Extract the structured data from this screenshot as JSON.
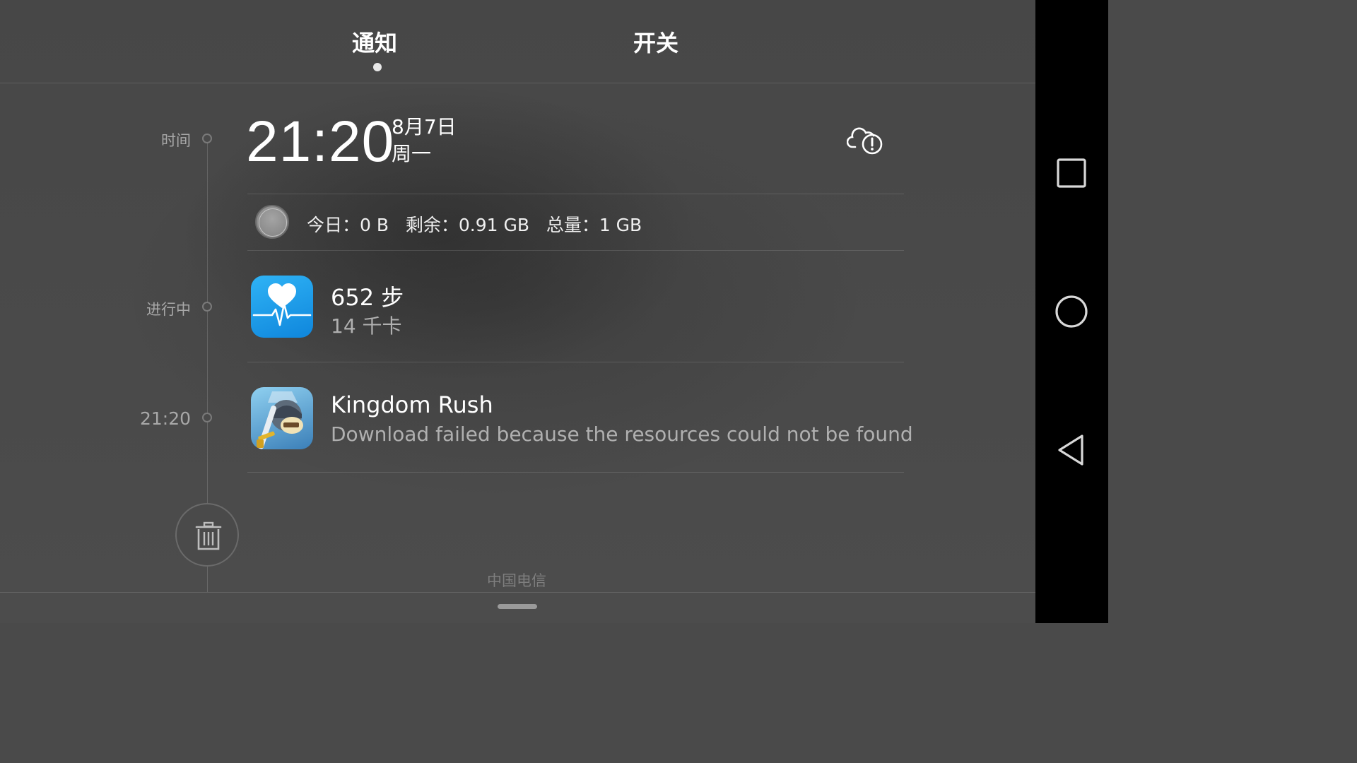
{
  "tabs": {
    "notifications_label": "通知",
    "switches_label": "开关",
    "active": "notifications_label"
  },
  "timeline": {
    "time_label": "时间",
    "ongoing_label": "进行中",
    "notif_time": "21:20"
  },
  "clock": {
    "time": "21:20",
    "date": "8月7日",
    "weekday": "周一",
    "weather_icon": "cloud-alert-icon"
  },
  "data_usage": {
    "text": "今日：0 B   剩余：0.91 GB   总量：1 GB"
  },
  "notifications": [
    {
      "app_icon": "health-heart-icon",
      "title": "652 步",
      "subtitle": "14 千卡"
    },
    {
      "app_icon": "kingdom-rush-icon",
      "title": "Kingdom Rush",
      "subtitle": "Download failed because the resources could not be found"
    }
  ],
  "footer": {
    "carrier": "中国电信",
    "clear_icon": "trash-icon"
  },
  "navbar": {
    "icons": [
      "recent-apps-icon",
      "home-icon",
      "back-icon"
    ]
  },
  "colors": {
    "background": "#4a4a4a",
    "navbar": "#000000",
    "health_icon": "#1a9ae8"
  }
}
